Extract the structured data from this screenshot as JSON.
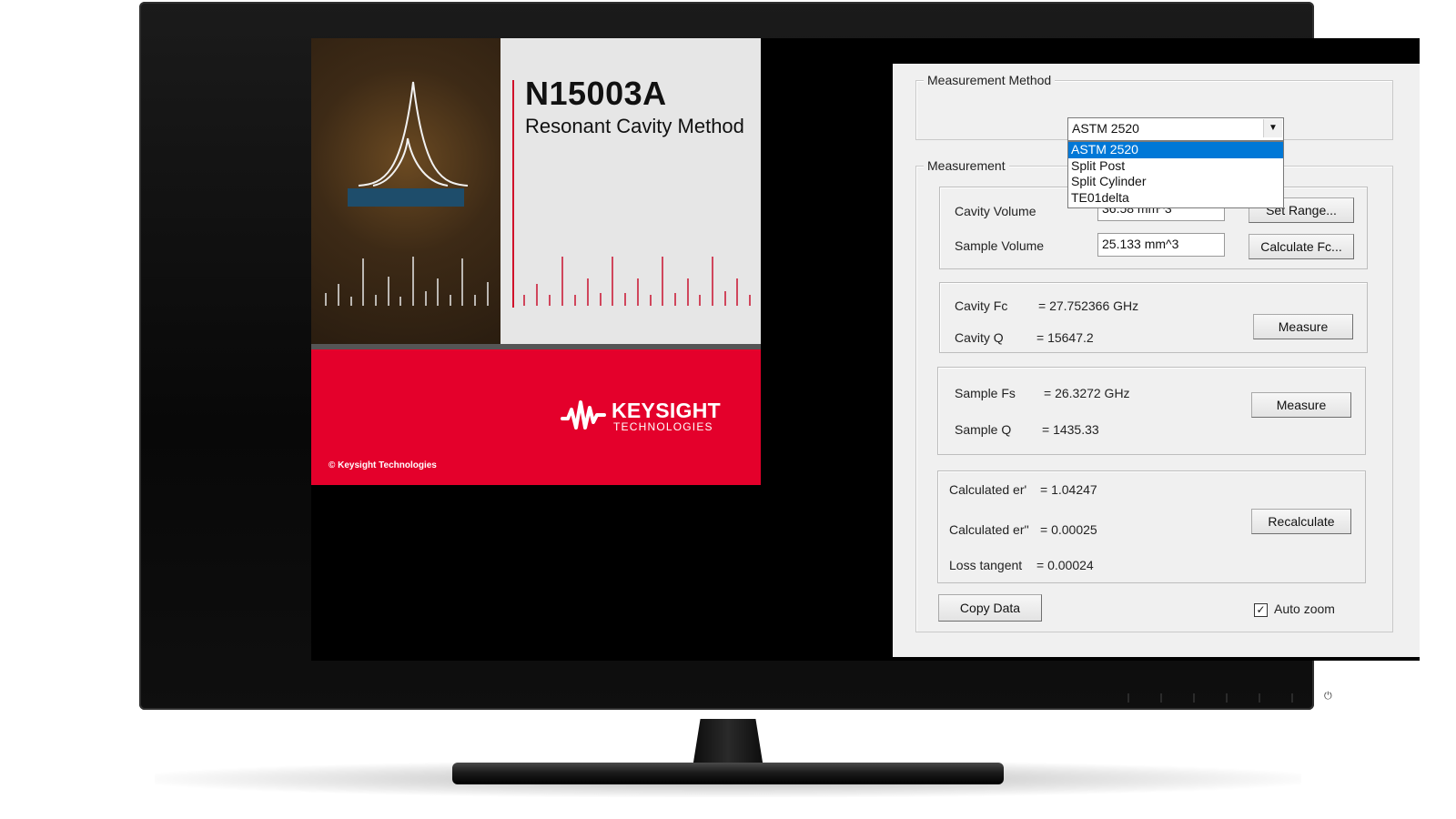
{
  "splash": {
    "product_code": "N15003A",
    "product_name": "Resonant Cavity Method",
    "brand": "KEYSIGHT",
    "brand_sub": "TECHNOLOGIES",
    "copyright": "© Keysight Technologies"
  },
  "dialog": {
    "method_group": {
      "legend": "Measurement Method",
      "selected": "ASTM 2520",
      "options": [
        "ASTM 2520",
        "Split Post",
        "Split Cylinder",
        "TE01delta"
      ]
    },
    "measurement_group": {
      "legend": "Measurement",
      "cavity_volume_label": "Cavity Volume",
      "cavity_volume_value": "36.58 mm^3",
      "sample_volume_label": "Sample Volume",
      "sample_volume_value": "25.133 mm^3",
      "set_range_button": "Set Range...",
      "calculate_fc_button": "Calculate Fc...",
      "cavity_fc_label": "Cavity Fc",
      "cavity_fc_value": "=  27.752366 GHz",
      "cavity_q_label": "Cavity Q",
      "cavity_q_value": "=  15647.2",
      "measure_cavity_button": "Measure",
      "sample_fs_label": "Sample Fs",
      "sample_fs_value": "=  26.3272 GHz",
      "sample_q_label": "Sample Q",
      "sample_q_value": "=  1435.33",
      "measure_sample_button": "Measure",
      "er_real_label": "Calculated er'",
      "er_real_value": "=  1.04247",
      "er_imag_label": "Calculated er''",
      "er_imag_value": "=  0.00025",
      "loss_tangent_label": "Loss tangent",
      "loss_tangent_value": "=  0.00024",
      "recalculate_button": "Recalculate",
      "copy_data_button": "Copy Data",
      "auto_zoom_label": "Auto zoom",
      "auto_zoom_checked": true
    }
  },
  "colors": {
    "keysight_red": "#e4002b",
    "selection_blue": "#0078d7",
    "dialog_bg": "#f0f0f0"
  }
}
